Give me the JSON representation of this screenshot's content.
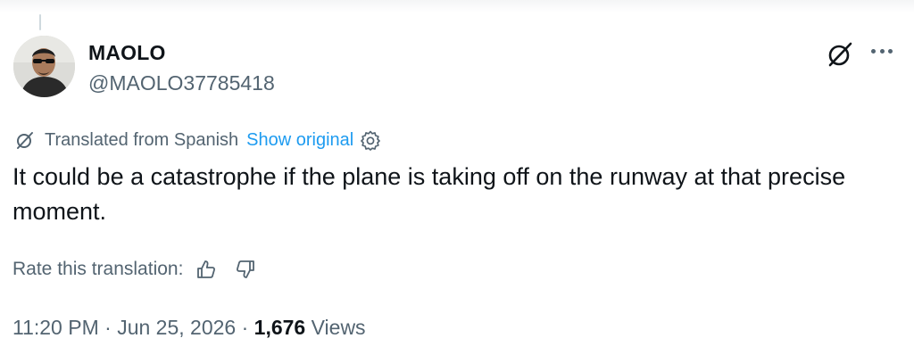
{
  "author": {
    "display_name": "MAOLO",
    "handle": "@MAOLO37785418"
  },
  "icons": {
    "grok": "grok-slash-circle-icon",
    "more": "more-horizontal-icon",
    "settings": "gear-icon",
    "thumbs_up": "thumbs-up-icon",
    "thumbs_down": "thumbs-down-icon"
  },
  "translation": {
    "notice": "Translated from Spanish",
    "show_original": "Show original"
  },
  "post": {
    "text": "It could be a catastrophe if the plane is taking off on the runway at that precise moment."
  },
  "rating": {
    "label": "Rate this translation:"
  },
  "meta": {
    "time": "11:20 PM",
    "separator": "·",
    "date": "Jun 25, 2026",
    "views_count": "1,676",
    "views_label": "Views"
  },
  "colors": {
    "text_primary": "#0f1419",
    "text_secondary": "#536471",
    "link": "#1d9bf0"
  }
}
